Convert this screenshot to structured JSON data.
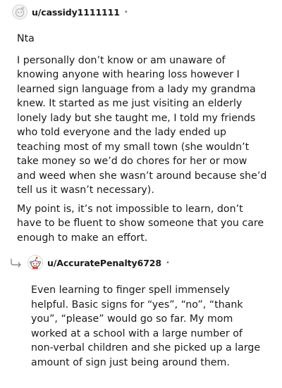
{
  "comments": [
    {
      "username": "u/cassidy1111111",
      "separator": "•",
      "paragraphs": [
        "Nta",
        "I personally don’t know or am unaware of knowing anyone with hearing loss however I learned sign language from a lady my grandma knew. It started as me just visiting an elderly lonely lady but she taught me, I told my friends who told everyone and the lady ended up teaching most of my small town (she wouldn’t take money so we’d do chores for her or mow and weed when she wasn’t around because she’d tell us it wasn’t necessary).",
        "My point is, it’s not impossible to learn, don’t have to be fluent to show someone that you care enough to make an effort."
      ]
    },
    {
      "username": "u/AccuratePenalty6728",
      "separator": "•",
      "paragraphs": [
        "Even learning to finger spell immensely helpful. Basic signs for “yes”, “no”, “thank you”, “please” would go so far. My mom worked at a school with a large number of non-verbal children and she picked up a large amount of sign just being around them."
      ]
    }
  ],
  "icons": {
    "avatar_1": "default-avatar-icon",
    "avatar_2": "snoo-avatar-icon",
    "reply": "reply-arrow-icon"
  },
  "colors": {
    "text": "#1a1a1b",
    "meta": "#7c7c7c",
    "avatar_gray": "#d0d0d0",
    "snoo_red": "#e8442d"
  }
}
